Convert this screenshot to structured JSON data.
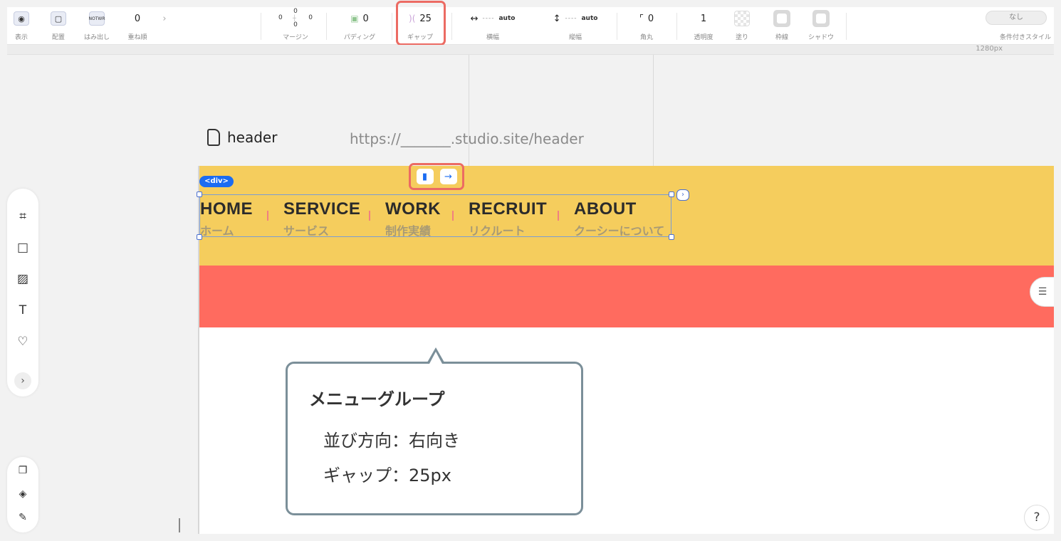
{
  "toolbar": {
    "display": {
      "label": "表示"
    },
    "position": {
      "label": "配置"
    },
    "overflow": {
      "label": "はみ出し",
      "icon_text": "NOTWR"
    },
    "zindex": {
      "value": "0",
      "label": "重ね順"
    },
    "margin": {
      "top": "0",
      "left": "0",
      "right": "0",
      "bottom": "0",
      "label": "マージン"
    },
    "padding": {
      "value": "0",
      "label": "パディング"
    },
    "gap": {
      "value": "25",
      "label": "ギャップ"
    },
    "width": {
      "value": "----",
      "unit": "auto",
      "label": "横幅"
    },
    "height": {
      "value": "----",
      "unit": "auto",
      "label": "縦幅"
    },
    "radius": {
      "value": "0",
      "label": "角丸"
    },
    "opacity": {
      "value": "1",
      "label": "透明度"
    },
    "fill": {
      "label": "塗り"
    },
    "border": {
      "label": "枠線"
    },
    "shadow": {
      "label": "シャドウ"
    },
    "conditional": {
      "button": "なし",
      "label": "条件付きスタイル"
    }
  },
  "ruler": {
    "breakpoint": "1280px"
  },
  "page": {
    "name": "header",
    "url": "https://_______.studio.site/header"
  },
  "selection": {
    "tag": "<div>"
  },
  "menu": [
    {
      "en": "HOME",
      "ja": "ホーム"
    },
    {
      "en": "SERVICE",
      "ja": "サービス"
    },
    {
      "en": "WORK",
      "ja": "制作実績"
    },
    {
      "en": "RECRUIT",
      "ja": "リクルート"
    },
    {
      "en": "ABOUT",
      "ja": "クーシーについて"
    }
  ],
  "callout": {
    "title": "メニューグループ",
    "line1": "並び方向：右向き",
    "line2": "ギャップ：25px"
  },
  "help": "?",
  "colors": {
    "header_bg": "#f5cd5d",
    "band_bg": "#ff6b5f",
    "highlight": "#ec6b63",
    "selection": "#1b6cf2",
    "callout_border": "#7b8f99"
  }
}
